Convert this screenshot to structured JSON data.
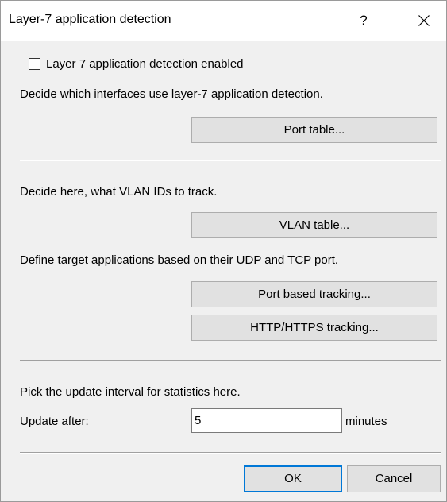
{
  "dialog": {
    "title": "Layer-7 application detection",
    "help_label": "?"
  },
  "detection": {
    "enabled_label": "Layer 7 application detection enabled",
    "enabled_checked": false,
    "interfaces_description": "Decide which interfaces use layer-7 application detection.",
    "port_table_button": "Port table..."
  },
  "vlan": {
    "description": "Decide here, what VLAN IDs to track.",
    "vlan_table_button": "VLAN table..."
  },
  "applications": {
    "description": "Define target applications based on their UDP and TCP port.",
    "port_based_button": "Port based tracking...",
    "http_button": "HTTP/HTTPS tracking..."
  },
  "statistics": {
    "description": "Pick the update interval for statistics here.",
    "update_label": "Update after:",
    "update_value": "5",
    "unit": "minutes"
  },
  "footer": {
    "ok_button": "OK",
    "cancel_button": "Cancel"
  },
  "colors": {
    "dialog_background": "#f0f0f0",
    "titlebar_background": "#ffffff",
    "button_face": "#e1e1e1",
    "default_button_border": "#0078d7"
  }
}
